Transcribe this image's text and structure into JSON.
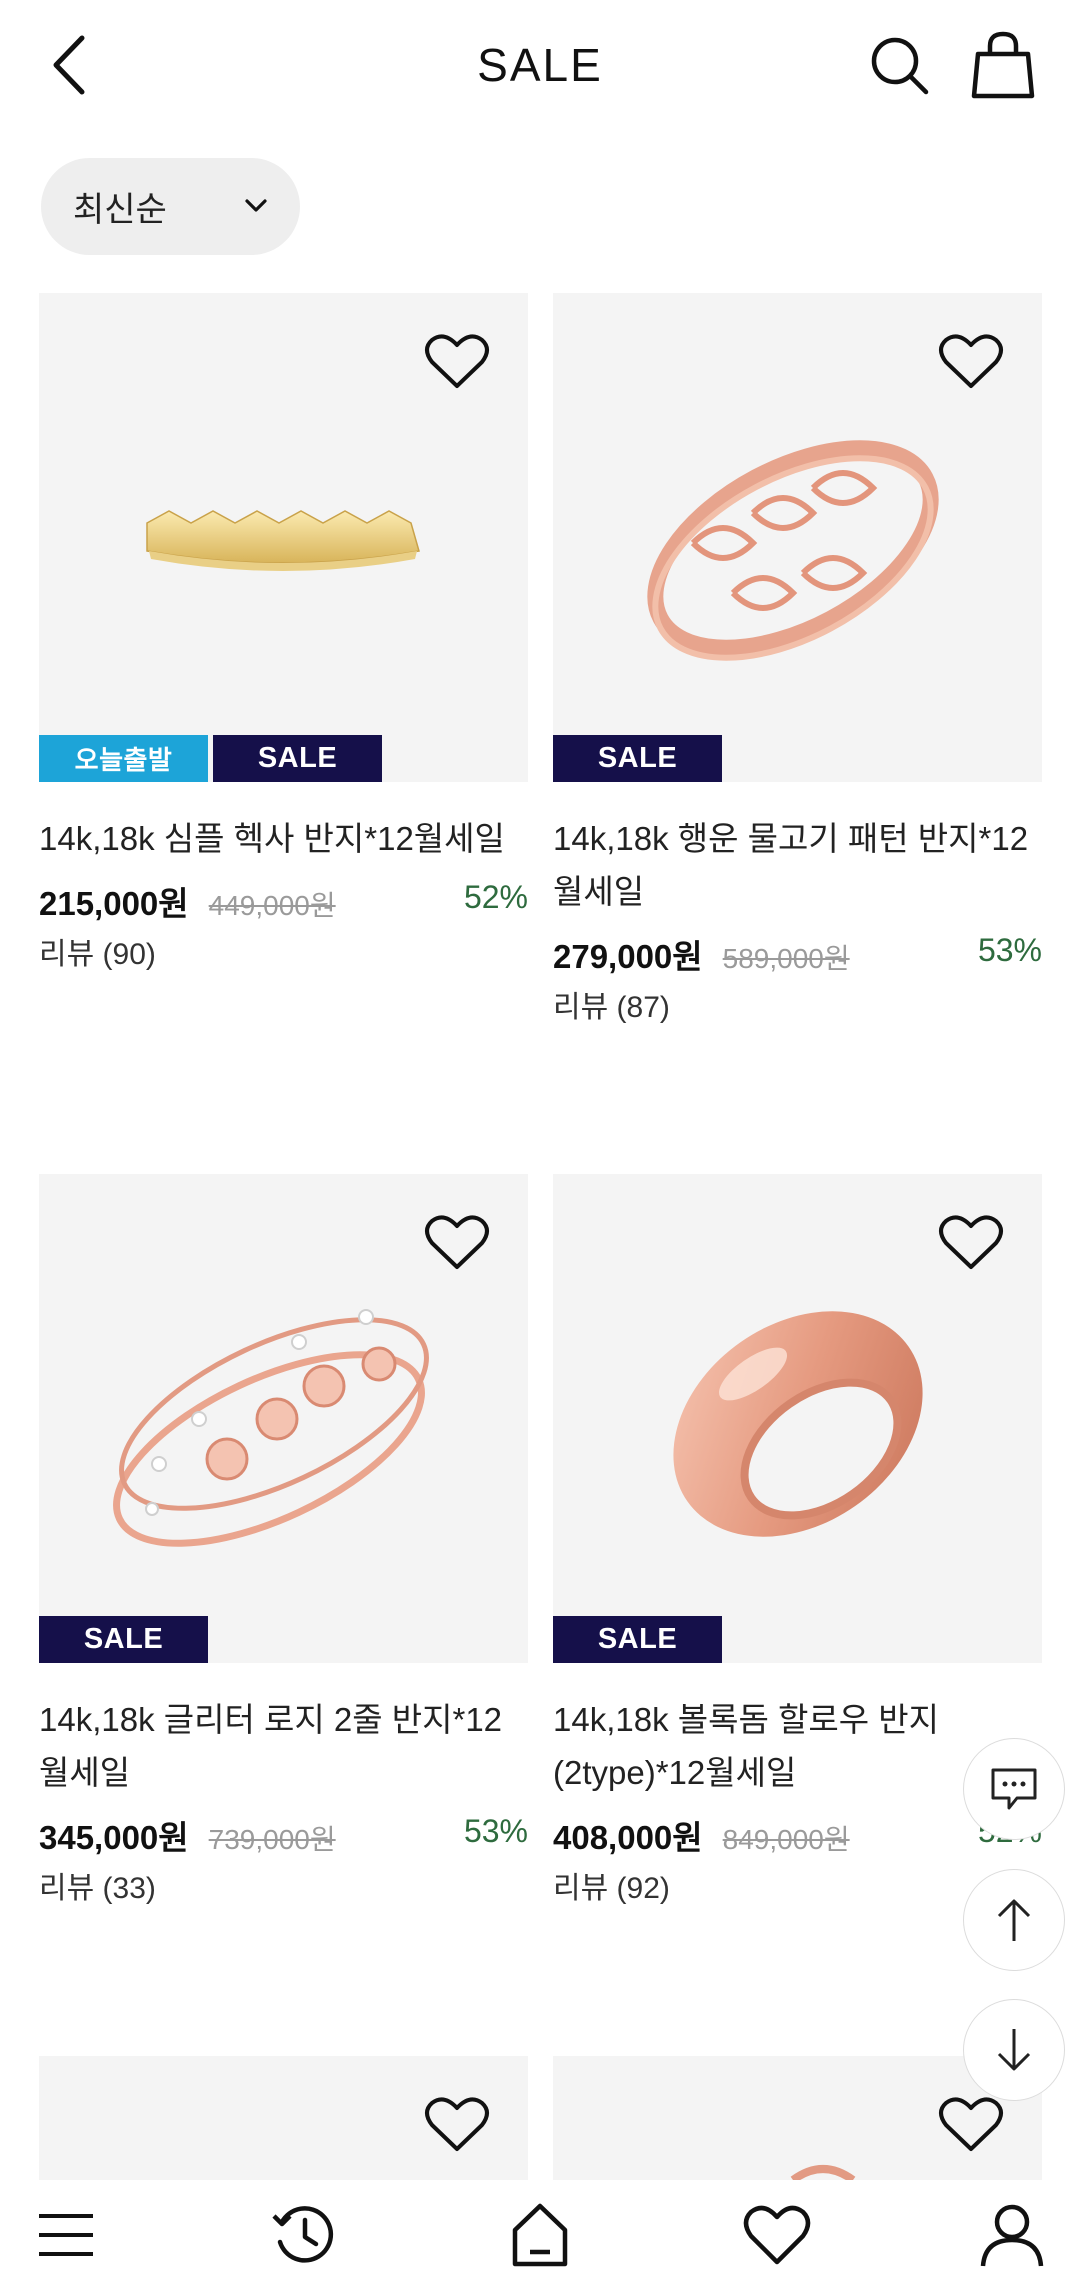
{
  "header": {
    "title": "SALE"
  },
  "sort": {
    "label": "최신순"
  },
  "products": [
    {
      "name": "14k,18k 심플 헥사 반지*12월세일",
      "price": "215,000원",
      "original_price": "449,000원",
      "discount": "52%",
      "reviews": "리뷰 (90)",
      "badges": [
        "오늘출발",
        "SALE"
      ]
    },
    {
      "name": "14k,18k 행운 물고기 패턴 반지*12월세일",
      "price": "279,000원",
      "original_price": "589,000원",
      "discount": "53%",
      "reviews": "리뷰 (87)",
      "badges": [
        "SALE"
      ]
    },
    {
      "name": "14k,18k 글리터 로지 2줄 반지*12월세일",
      "price": "345,000원",
      "original_price": "739,000원",
      "discount": "53%",
      "reviews": "리뷰 (33)",
      "badges": [
        "SALE"
      ]
    },
    {
      "name": "14k,18k 볼록돔 할로우 반지(2type)*12월세일",
      "price": "408,000원",
      "original_price": "849,000원",
      "discount": "52%",
      "reviews": "리뷰 (92)",
      "badges": [
        "SALE"
      ]
    }
  ],
  "floating_buttons": [
    "chat-icon",
    "arrow-up-icon",
    "arrow-down-icon"
  ],
  "bottom_nav": [
    "menu-icon",
    "history-icon",
    "home-icon",
    "heart-icon",
    "user-icon"
  ],
  "colors": {
    "sale_badge": "#15104a",
    "today_badge": "#1da4d8",
    "discount": "#2e6b3e",
    "image_bg": "#f4f4f4"
  }
}
